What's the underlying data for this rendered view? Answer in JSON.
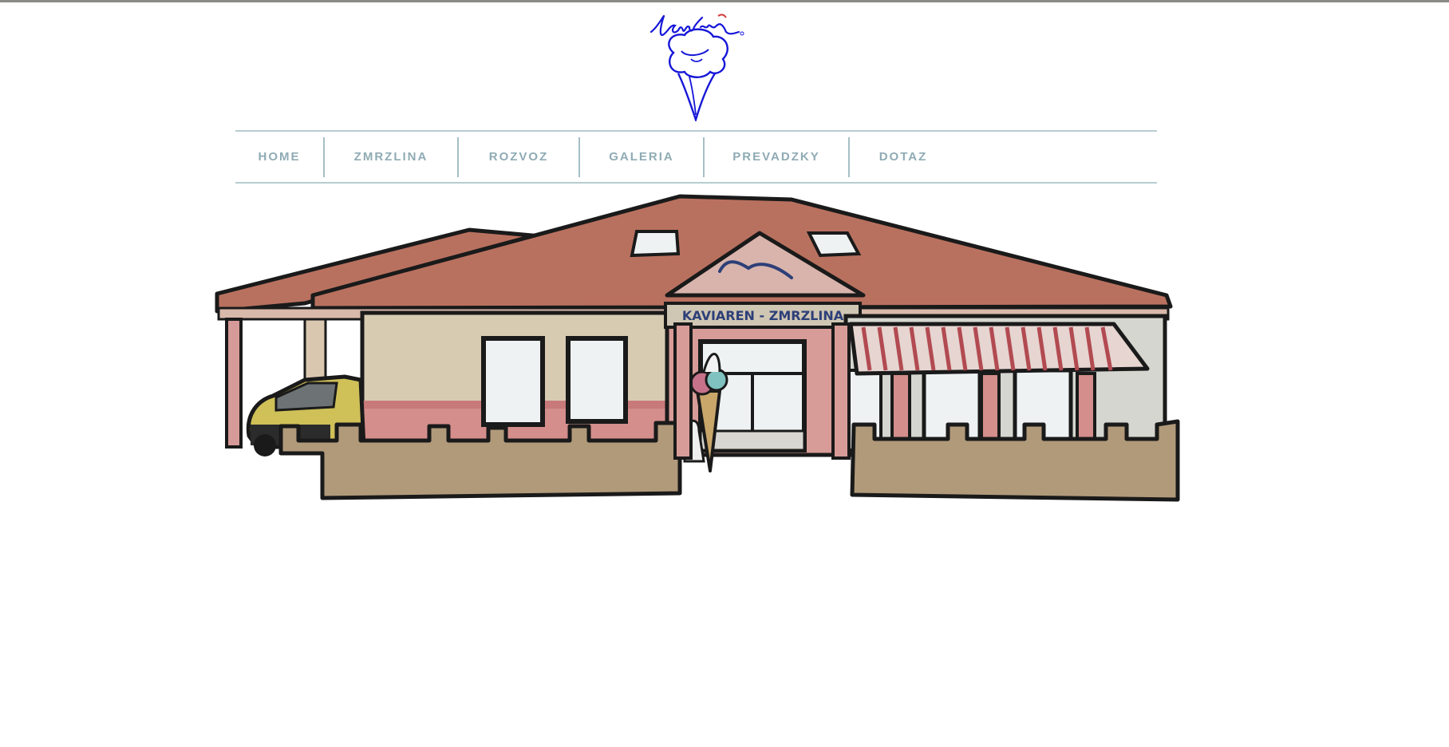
{
  "brand": {
    "logo_text": "Vanilia",
    "accent_color": "#1616d8"
  },
  "nav": {
    "items": [
      {
        "label": "HOME"
      },
      {
        "label": "ZMRZLINA"
      },
      {
        "label": "ROZVOZ"
      },
      {
        "label": "GALERIA"
      },
      {
        "label": "PREVADZKY"
      },
      {
        "label": "DOTAZ"
      }
    ],
    "text_color": "#8fabb4",
    "line_color": "#b7cdcf"
  },
  "hero": {
    "image_description": "illustrated cafe building",
    "sign_line": "KAVIAREN - ZMRZLINA"
  }
}
